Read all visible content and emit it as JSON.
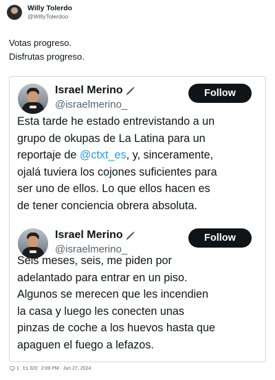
{
  "outer_tweet": {
    "author_name": "Willy Tolerdo",
    "author_handle": "@WillyTolerdoo",
    "text_lines": [
      "Votas progreso.",
      "Disfrutas progreso."
    ]
  },
  "embedded_tweets": [
    {
      "author_name": "Israel Merino",
      "author_handle": "@israelmerino_",
      "follow_label": "Follow",
      "name_icon": "fountain-pen-emoji",
      "body_lines": [
        {
          "before": "Esta tarde he estado entrevistando a un"
        },
        {
          "before": "grupo de okupas de La Latina para un"
        },
        {
          "before": "reportaje de ",
          "mention": "@ctxt_es",
          "after": ", y, sinceramente,"
        },
        {
          "before": "ojalá tuviera los cojones suficientes para"
        },
        {
          "before": "ser uno de ellos. Lo que ellos hacen es"
        },
        {
          "before": "de tener conciencia obrera absoluta."
        }
      ]
    },
    {
      "author_name": "Israel Merino",
      "author_handle": "@israelmerino_",
      "follow_label": "Follow",
      "name_icon": "fountain-pen-emoji",
      "body_lines": [
        {
          "before": "Seis meses, seis, me piden por"
        },
        {
          "before": "adelantado para entrar en un piso."
        },
        {
          "before": "Algunos se merecen que les incendien"
        },
        {
          "before": "la casa y luego les conecten unas"
        },
        {
          "before": "pinzas de coche a los huevos hasta que"
        },
        {
          "before": "apaguen el fuego a lefazos."
        }
      ]
    }
  ],
  "footer": {
    "replies": "1",
    "retweets": "320",
    "timestamp": "2:09 PM · Jun 27, 2024",
    "reply_icon": "reply-icon",
    "retweet_icon": "retweet-icon"
  },
  "colors": {
    "text": "#0f1419",
    "secondary": "#536471",
    "mention": "#1d9bf0",
    "follow_bg": "#0f1419",
    "border": "#cfd9de"
  }
}
